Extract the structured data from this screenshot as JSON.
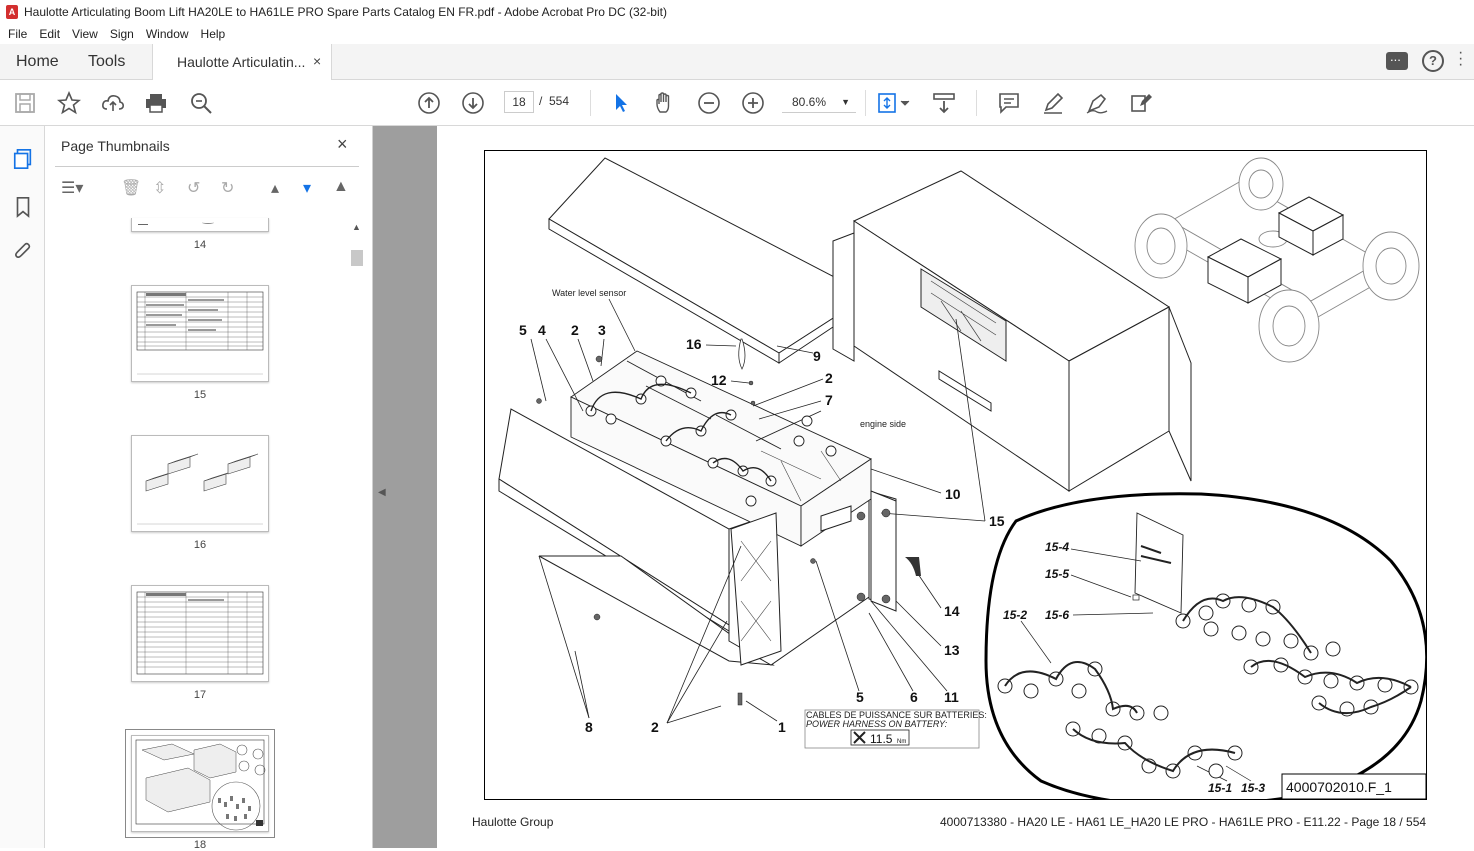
{
  "window": {
    "title": "Haulotte Articulating Boom Lift  HA20LE to HA61LE PRO Spare Parts Catalog EN FR.pdf - Adobe Acrobat Pro DC (32-bit)",
    "app_icon": "acrobat-icon"
  },
  "menu": [
    "File",
    "Edit",
    "View",
    "Sign",
    "Window",
    "Help"
  ],
  "tabs": {
    "home": "Home",
    "tools": "Tools",
    "document": "Haulotte Articulatin...",
    "close": "×"
  },
  "toolbar": {
    "current_page": "18",
    "page_sep": "/",
    "total_pages": "554",
    "zoom": "80.6%"
  },
  "thumbnails": {
    "title": "Page Thumbnails",
    "close": "×",
    "pages": [
      "14",
      "15",
      "16",
      "17",
      "18"
    ],
    "selected": "18"
  },
  "drawing": {
    "labels": {
      "water_level_sensor": "Water level sensor",
      "engine_side": "engine side",
      "cables_fr": "CABLES DE PUISSANCE SUR BATTERIES:",
      "cables_en": "POWER HARNESS ON BATTERY:",
      "torque": "11.5",
      "torque_unit": "Nm",
      "ref": "4000702010.F_1"
    },
    "callouts": [
      "5",
      "4",
      "2",
      "3",
      "16",
      "9",
      "12",
      "2",
      "7",
      "10",
      "15",
      "14",
      "13",
      "11",
      "6",
      "5",
      "1",
      "2",
      "8"
    ],
    "detail_callouts": [
      "15-4",
      "15-5",
      "15-6",
      "15-2",
      "15-1",
      "15-3"
    ]
  },
  "footer": {
    "left": "Haulotte Group",
    "right": "4000713380 - HA20 LE - HA61 LE_HA20 LE PRO - HA61LE PRO - E11.22 - Page 18 / 554"
  }
}
